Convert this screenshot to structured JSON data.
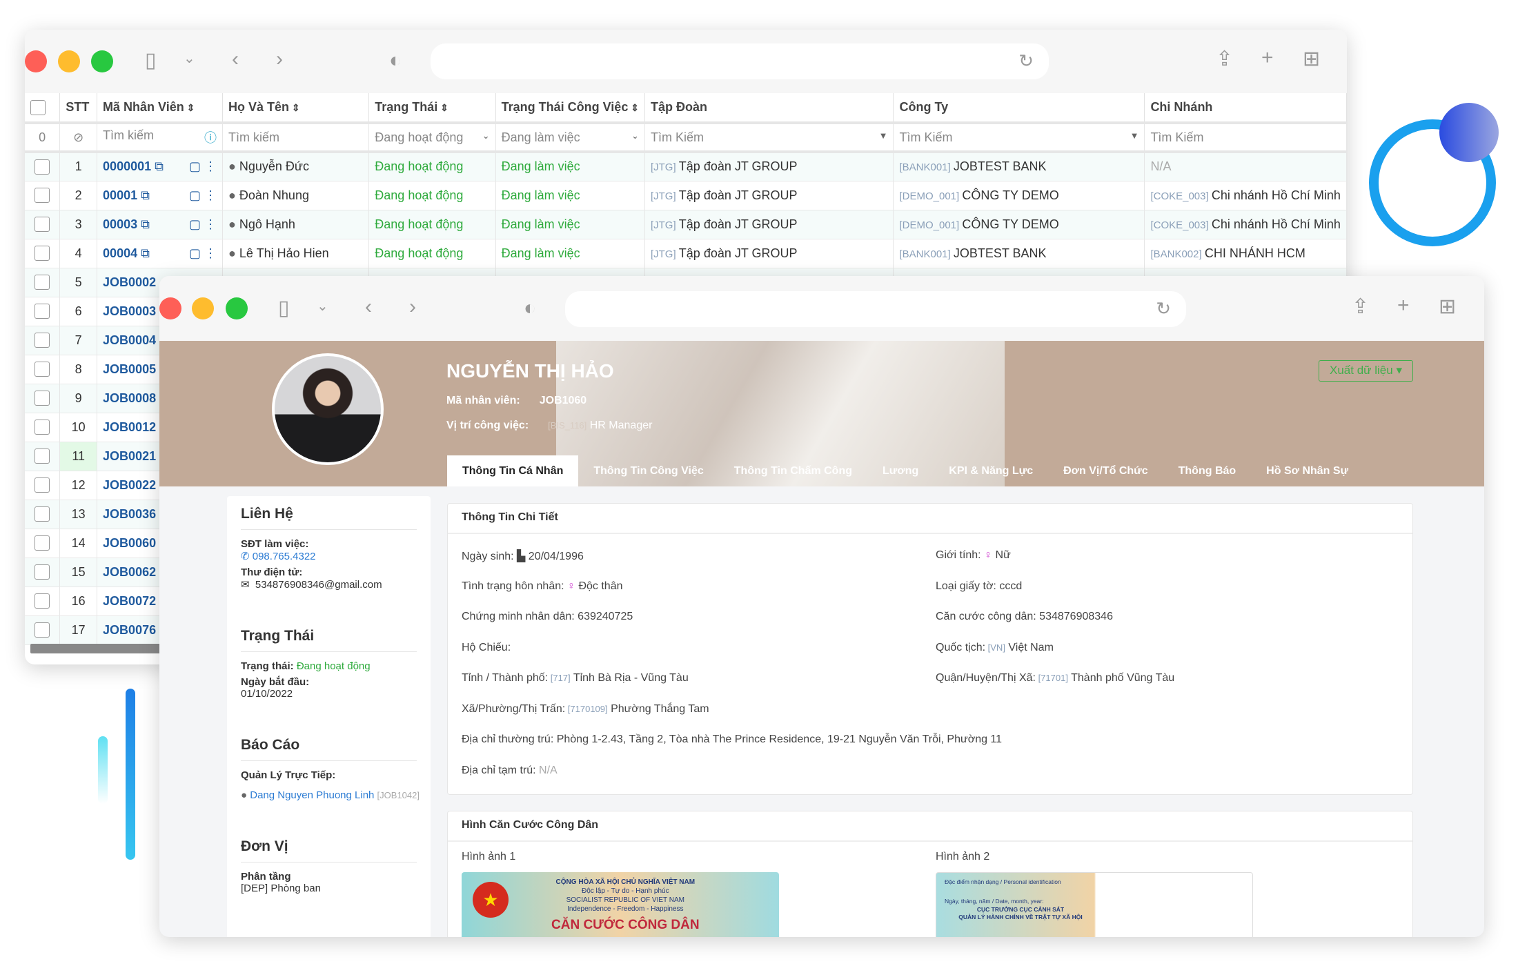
{
  "colors": {
    "accent_green": "#2eaa3c",
    "link_blue": "#1f5a9e",
    "banner": "#c2aa98",
    "close": "#fe5f57",
    "minimize": "#febc2e",
    "maximize": "#28c840"
  },
  "back_window": {
    "columns": [
      "",
      "STT",
      "Mã Nhân Viên",
      "Họ Và Tên",
      "Trạng Thái",
      "Trạng Thái Công Việc",
      "Tập Đoàn",
      "Công Ty",
      "Chi Nhánh"
    ],
    "filters": {
      "row_index": "0",
      "ma_nv": "Tìm kiếm",
      "ho_ten": "Tìm kiếm",
      "trang_thai": "Đang hoạt động",
      "tt_cong_viec": "Đang làm việc",
      "tap_doan": "Tìm Kiếm",
      "cong_ty": "Tìm Kiếm",
      "chi_nhanh": "Tìm Kiếm"
    },
    "rows": [
      {
        "stt": "1",
        "code": "0000001",
        "name": "Nguyễn Đức",
        "status": "Đang hoạt động",
        "work": "Đang làm việc",
        "group_tag": "[JTG]",
        "group": "Tập đoàn JT GROUP",
        "company_tag": "[BANK001]",
        "company": "JOBTEST BANK",
        "branch_tag": "",
        "branch": "N/A"
      },
      {
        "stt": "2",
        "code": "00001",
        "name": "Đoàn Nhung",
        "status": "Đang hoạt động",
        "work": "Đang làm việc",
        "group_tag": "[JTG]",
        "group": "Tập đoàn JT GROUP",
        "company_tag": "[DEMO_001]",
        "company": "CÔNG TY DEMO",
        "branch_tag": "[COKE_003]",
        "branch": "Chi nhánh Hồ Chí Minh"
      },
      {
        "stt": "3",
        "code": "00003",
        "name": "Ngô Hạnh",
        "status": "Đang hoạt động",
        "work": "Đang làm việc",
        "group_tag": "[JTG]",
        "group": "Tập đoàn JT GROUP",
        "company_tag": "[DEMO_001]",
        "company": "CÔNG TY DEMO",
        "branch_tag": "[COKE_003]",
        "branch": "Chi nhánh Hồ Chí Minh"
      },
      {
        "stt": "4",
        "code": "00004",
        "name": "Lê Thị Hảo Hien",
        "status": "Đang hoạt động",
        "work": "Đang làm việc",
        "group_tag": "[JTG]",
        "group": "Tập đoàn JT GROUP",
        "company_tag": "[BANK001]",
        "company": "JOBTEST BANK",
        "branch_tag": "[BANK002]",
        "branch": "CHI NHÁNH HCM"
      },
      {
        "stt": "5",
        "code": "JOB0002"
      },
      {
        "stt": "6",
        "code": "JOB0003"
      },
      {
        "stt": "7",
        "code": "JOB0004"
      },
      {
        "stt": "8",
        "code": "JOB0005"
      },
      {
        "stt": "9",
        "code": "JOB0008"
      },
      {
        "stt": "10",
        "code": "JOB0012"
      },
      {
        "stt": "11",
        "code": "JOB0021"
      },
      {
        "stt": "12",
        "code": "JOB0022"
      },
      {
        "stt": "13",
        "code": "JOB0036"
      },
      {
        "stt": "14",
        "code": "JOB0060"
      },
      {
        "stt": "15",
        "code": "JOB0062"
      },
      {
        "stt": "16",
        "code": "JOB0072"
      },
      {
        "stt": "17",
        "code": "JOB0076"
      }
    ]
  },
  "profile": {
    "name": "NGUYỄN THỊ HẢO",
    "employee_code_label": "Mã nhân viên:",
    "employee_code": "JOB1060",
    "position_label": "Vị trí công việc:",
    "position_tag": "[BIS_116]",
    "position": "HR Manager",
    "export_button": "Xuất dữ liệu ▾",
    "tabs": [
      "Thông Tin Cá Nhân",
      "Thông Tin Công Việc",
      "Thông Tin Chấm Công",
      "Lương",
      "KPI & Năng Lực",
      "Đơn Vị/Tổ Chức",
      "Thông Báo",
      "Hồ Sơ Nhân Sự"
    ],
    "active_tab": "Thông Tin Cá Nhân"
  },
  "sidebar": {
    "contact_title": "Liên Hệ",
    "phone_label": "SĐT làm việc:",
    "phone": "098.765.4322",
    "email_label": "Thư điện tử:",
    "email": "534876908346@gmail.com",
    "status_title": "Trạng Thái",
    "status_label": "Trạng thái:",
    "status": "Đang hoạt động",
    "start_label": "Ngày bắt đầu:",
    "start_date": "01/10/2022",
    "report_title": "Báo Cáo",
    "manager_label": "Quản Lý Trực Tiếp:",
    "manager": "Dang Nguyen Phuong Linh",
    "manager_code": "[JOB1042]",
    "unit_title": "Đơn Vị",
    "tier_label": "Phân tầng",
    "tier": "[DEP] Phòng ban"
  },
  "details": {
    "title": "Thông Tin Chi Tiết",
    "fields": [
      {
        "label": "Ngày sinh:",
        "icon": "cake-icon",
        "value": "20/04/1996"
      },
      {
        "label": "Giới tính:",
        "icon": "female-icon",
        "value": "Nữ"
      },
      {
        "label": "Tình trạng hôn nhân:",
        "icon": "female-icon",
        "value": "Độc thân"
      },
      {
        "label": "Loại giấy tờ:",
        "value": "cccd"
      },
      {
        "label": "Chứng minh nhân dân:",
        "value": "639240725"
      },
      {
        "label": "Căn cước công dân:",
        "value": "534876908346"
      },
      {
        "label": "Hộ Chiếu:",
        "value": ""
      },
      {
        "label": "Quốc tịch:",
        "tag": "[VN]",
        "value": "Việt Nam"
      },
      {
        "label": "Tỉnh / Thành phố:",
        "tag": "[717]",
        "value": "Tỉnh Bà Rịa - Vũng Tàu"
      },
      {
        "label": "Quận/Huyện/Thị Xã:",
        "tag": "[71701]",
        "value": "Thành phố Vũng Tàu"
      },
      {
        "label": "Xã/Phường/Thị Trấn:",
        "tag": "[7170109]",
        "value": "Phường Thắng Tam"
      },
      {
        "label": "Địa chỉ thường trú:",
        "value": "Phòng 1-2.43, Tầng 2, Tòa nhà The Prince Residence, 19-21 Nguyễn Văn Trỗi, Phường 11"
      },
      {
        "label": "Địa chỉ tạm trú:",
        "muted": "N/A"
      }
    ]
  },
  "id_card": {
    "title": "Hình Căn Cước Công Dân",
    "image1_label": "Hình ảnh 1",
    "image2_label": "Hình ảnh 2",
    "front_text": [
      "CỘNG HÒA XÃ HỘI CHỦ NGHĨA VIỆT NAM",
      "Độc lập - Tự do - Hạnh phúc",
      "SOCIALIST REPUBLIC OF VIET NAM",
      "Independence - Freedom - Happiness",
      "CĂN CƯỚC CÔNG DÂN"
    ],
    "back_text": [
      "Đặc điểm nhận dạng / Personal identification",
      "Ngày, tháng, năm / Date, month, year:",
      "CỤC TRƯỞNG CỤC CẢNH SÁT",
      "QUẢN LÝ HÀNH CHÍNH VỀ TRẬT TỰ XÃ HỘI"
    ]
  }
}
